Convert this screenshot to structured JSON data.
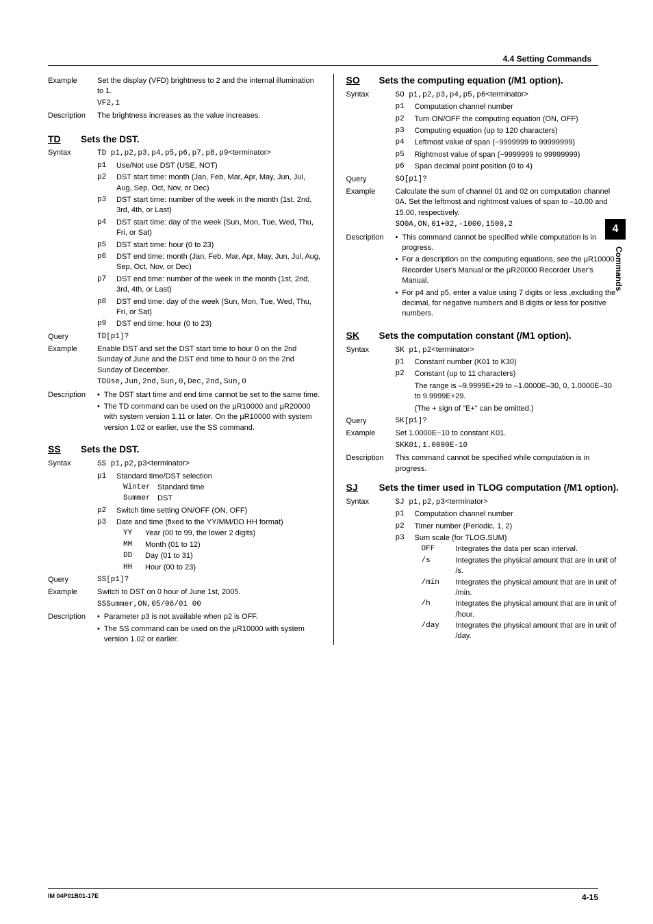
{
  "header": {
    "section": "4.4  Setting Commands"
  },
  "sideTab": {
    "number": "4",
    "label": "Commands"
  },
  "footer": {
    "left": "IM 04P01B01-17E",
    "right": "4-15"
  },
  "left": {
    "vf": {
      "example_lbl": "Example",
      "example_text": "Set the display (VFD) brightness to 2 and the internal illumination to 1.",
      "example_code": "VF2,1",
      "desc_lbl": "Description",
      "desc_text": "The brightness increases as the value increases."
    },
    "td": {
      "code": "TD",
      "title": "Sets the DST.",
      "syntax_lbl": "Syntax",
      "syntax_code": "TD p1,p2,p3,p4,p5,p6,p7,p8,p9",
      "term": "<terminator>",
      "params": [
        {
          "c": "p1",
          "t": "Use/Not use DST (USE, NOT)"
        },
        {
          "c": "p2",
          "t": "DST start time: month (Jan, Feb, Mar, Apr, May, Jun, Jul, Aug, Sep, Oct, Nov, or Dec)"
        },
        {
          "c": "p3",
          "t": "DST start time: number of the week in the month (1st, 2nd, 3rd, 4th, or Last)"
        },
        {
          "c": "p4",
          "t": "DST start time: day of the week (Sun, Mon, Tue, Wed, Thu, Fri, or Sat)"
        },
        {
          "c": "p5",
          "t": "DST start time: hour (0 to 23)"
        },
        {
          "c": "p6",
          "t": "DST end time: month (Jan, Feb, Mar, Apr, May, Jun, Jul, Aug, Sep, Oct, Nov, or Dec)"
        },
        {
          "c": "p7",
          "t": "DST end time: number of the week in the month (1st, 2nd, 3rd, 4th, or Last)"
        },
        {
          "c": "p8",
          "t": "DST end time: day of the week (Sun, Mon, Tue, Wed, Thu, Fri, or Sat)"
        },
        {
          "c": "p9",
          "t": "DST end time: hour (0 to 23)"
        }
      ],
      "query_lbl": "Query",
      "query_code": "TD[p1]?",
      "example_lbl": "Example",
      "example_text": "Enable DST and set the DST start time to hour 0 on the 2nd Sunday of June and the DST end time to hour 0 on the 2nd Sunday of December.",
      "example_code": "TDUse,Jun,2nd,Sun,0,Dec,2nd,Sun,0",
      "desc_lbl": "Description",
      "desc_items": [
        "The DST start time and end time cannot be set to the same time.",
        "The TD command can be used on the µR10000 and µR20000 with system version 1.11 or later. On the µR10000 with system version 1.02 or earlier, use the SS command."
      ]
    },
    "ss": {
      "code": "SS",
      "title": "Sets the DST.",
      "syntax_lbl": "Syntax",
      "syntax_code": "SS p1,p2,p3",
      "term": "<terminator>",
      "p1": {
        "c": "p1",
        "t": "Standard time/DST selection"
      },
      "p1_winter_c": "Winter",
      "p1_winter_t": "Standard time",
      "p1_summer_c": "Summer",
      "p1_summer_t": "DST",
      "p2": {
        "c": "p2",
        "t": "Switch time setting ON/OFF (ON, OFF)"
      },
      "p3": {
        "c": "p3",
        "t": "Date and time (fixed to the YY/MM/DD HH format)"
      },
      "p3_subs": [
        {
          "c": "YY",
          "t": "Year (00 to 99, the lower 2 digits)"
        },
        {
          "c": "MM",
          "t": "Month (01 to 12)"
        },
        {
          "c": "DD",
          "t": "Day (01 to 31)"
        },
        {
          "c": "HH",
          "t": "Hour (00 to 23)"
        }
      ],
      "query_lbl": "Query",
      "query_code": "SS[p1]?",
      "example_lbl": "Example",
      "example_text": "Switch to DST on 0 hour of June 1st, 2005.",
      "example_code": "SSSummer,ON,05/06/01 00",
      "desc_lbl": "Description",
      "desc_items": [
        "Parameter p3 is not available when p2 is OFF.",
        "The SS command can be used on the µR10000 with system version 1.02 or earlier."
      ]
    }
  },
  "right": {
    "so": {
      "code": "SO",
      "title": "Sets the computing equation (/M1 option).",
      "syntax_lbl": "Syntax",
      "syntax_code": "SO p1,p2,p3,p4,p5,p6",
      "term": "<terminator>",
      "params": [
        {
          "c": "p1",
          "t": "Computation channel number"
        },
        {
          "c": "p2",
          "t": "Turn ON/OFF the computing equation (ON, OFF)"
        },
        {
          "c": "p3",
          "t": "Computing equation (up to 120 characters)"
        },
        {
          "c": "p4",
          "t": "Leftmost value of span (−9999999 to 99999999)"
        },
        {
          "c": "p5",
          "t": "Rightmost value of span (−9999999 to 99999999)"
        },
        {
          "c": "p6",
          "t": "Span decimal point position (0 to 4)"
        }
      ],
      "query_lbl": "Query",
      "query_code": "SO[p1]?",
      "example_lbl": "Example",
      "example_text": "Calculate the sum of channel 01 and 02 on computation channel 0A. Set the leftmost and rightmost values of span to –10.00 and 15.00, respectively.",
      "example_code": "SO0A,ON,01+02,-1000,1500,2",
      "desc_lbl": "Description",
      "desc_items": [
        "This command cannot be specified while computation is in progress.",
        "For a description on the computing equations, see the µR10000 Recorder User's Manual or the µR20000 Recorder User's Manual.",
        "For p4 and p5, enter a value using 7 digits or less ,excluding the decimal, for negative numbers and 8 digits or less for positive numbers."
      ]
    },
    "sk": {
      "code": "SK",
      "title": "Sets the computation constant (/M1 option).",
      "syntax_lbl": "Syntax",
      "syntax_code": "SK p1,p2",
      "term": "<terminator>",
      "params": [
        {
          "c": "p1",
          "t": "Constant number (K01 to K30)"
        },
        {
          "c": "p2",
          "t": "Constant (up to 11 characters)"
        }
      ],
      "p2_extra1": "The range is –9.9999E+29 to –1.0000E–30, 0, 1.0000E–30 to 9.9999E+29.",
      "p2_extra2": "(The + sign of \"E+\" can be omitted.)",
      "query_lbl": "Query",
      "query_code": "SK[p1]?",
      "example_lbl": "Example",
      "example_text": "Set 1.0000E−10 to constant K01.",
      "example_code": "SKK01,1.0000E-10",
      "desc_lbl": "Description",
      "desc_text": "This command cannot be specified while computation is in progress."
    },
    "sj": {
      "code": "SJ",
      "title": "Sets the timer used in TLOG computation (/M1 option).",
      "syntax_lbl": "Syntax",
      "syntax_code": "SJ p1,p2,p3",
      "term": "<terminator>",
      "params": [
        {
          "c": "p1",
          "t": "Computation channel number"
        },
        {
          "c": "p2",
          "t": "Timer number (Periodic, 1, 2)"
        },
        {
          "c": "p3",
          "t": "Sum scale (for TLOG.SUM)"
        }
      ],
      "p3_subs": [
        {
          "c": "OFF",
          "t": "Integrates the data per scan interval."
        },
        {
          "c": "/s",
          "t": "Integrates the physical amount that are in unit of /s."
        },
        {
          "c": "/min",
          "t": "Integrates the physical amount that are in unit of /min."
        },
        {
          "c": "/h",
          "t": "Integrates the physical amount that are in unit of /hour."
        },
        {
          "c": "/day",
          "t": "Integrates the physical amount that are in unit of /day."
        }
      ]
    }
  }
}
